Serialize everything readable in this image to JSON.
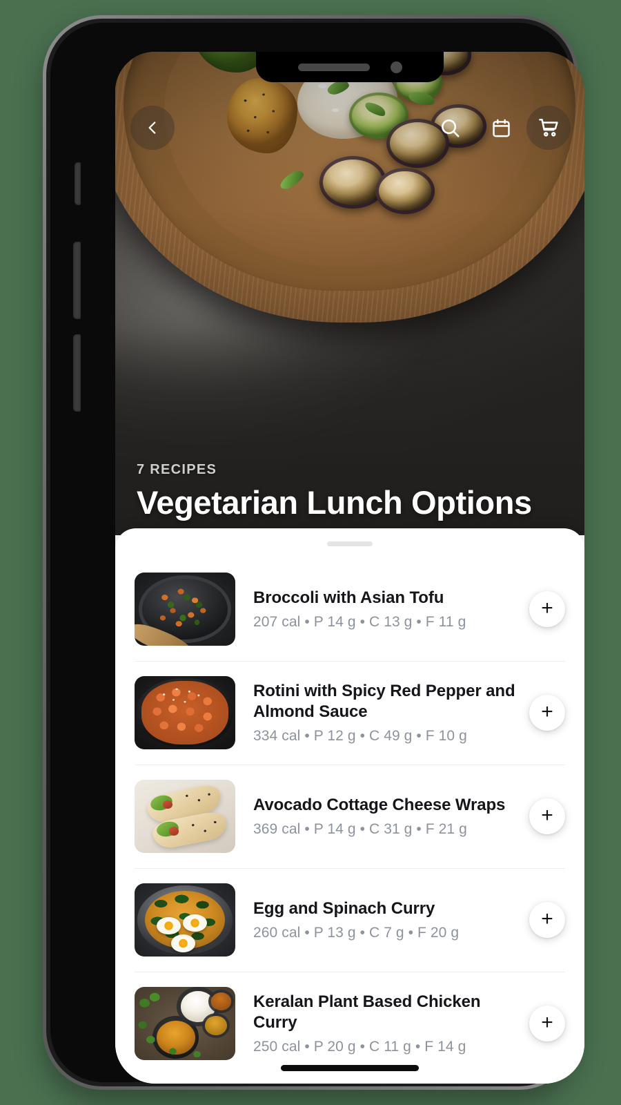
{
  "background_color": "#4a7050",
  "device": {
    "notch": {
      "speaker_icon": "speaker-grille",
      "camera_icon": "front-camera-dot"
    },
    "buttons": {
      "silent_switch": "silent-switch",
      "volume_up": "volume-up-button",
      "volume_down": "volume-down-button",
      "power": "power-button"
    },
    "home_indicator": "home-indicator"
  },
  "topnav": {
    "back_icon": "chevron-left-icon",
    "search_icon": "search-icon",
    "calendar_icon": "calendar-icon",
    "cart_icon": "shopping-cart-icon"
  },
  "hero": {
    "eyebrow": "7 RECIPES",
    "title": "Vegetarian Lunch Options",
    "photo_alt": "wooden-bowl-grilled-vegetables"
  },
  "sheet": {
    "handle": "drag-handle",
    "add_label": "+",
    "recipes": [
      {
        "title": "Broccoli with Asian Tofu",
        "macros": "207 cal • P 14 g • C 13 g • F 11 g",
        "thumb": "tofu-broccoli-skillet"
      },
      {
        "title": "Rotini with Spicy Red Pepper and Almond Sauce",
        "macros": "334 cal • P 12 g • C 49 g • F 10 g",
        "thumb": "rotini-pasta-skillet"
      },
      {
        "title": "Avocado Cottage Cheese Wraps",
        "macros": "369 cal • P 14 g • C 31 g • F 21 g",
        "thumb": "avocado-wraps"
      },
      {
        "title": "Egg and Spinach Curry",
        "macros": "260 cal • P 13 g • C 7 g • F 20 g",
        "thumb": "egg-spinach-curry"
      },
      {
        "title": "Keralan Plant Based Chicken Curry",
        "macros": "250 cal • P 20 g • C 11 g • F 14 g",
        "thumb": "keralan-curry-spread"
      }
    ]
  }
}
